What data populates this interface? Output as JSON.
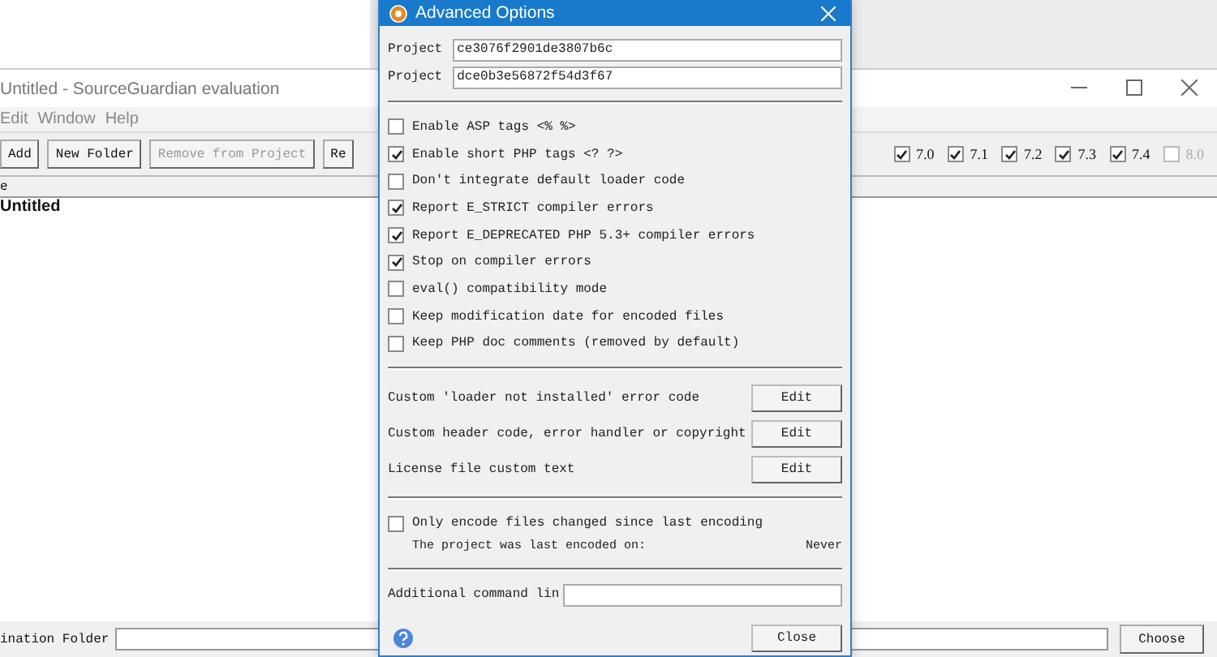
{
  "main_window": {
    "title": "Untitled - SourceGuardian evaluation",
    "menu": [
      "Edit",
      "Window",
      "Help"
    ],
    "toolbar": [
      {
        "label": "Add",
        "disabled": false
      },
      {
        "label": "New Folder",
        "disabled": false
      },
      {
        "label": "Remove from Project",
        "disabled": true
      },
      {
        "label": "Re",
        "disabled": false
      }
    ],
    "versions": [
      {
        "label": "7.0",
        "checked": true,
        "disabled": false
      },
      {
        "label": "7.1",
        "checked": true,
        "disabled": false
      },
      {
        "label": "7.2",
        "checked": true,
        "disabled": false
      },
      {
        "label": "7.3",
        "checked": true,
        "disabled": false
      },
      {
        "label": "7.4",
        "checked": true,
        "disabled": false
      },
      {
        "label": "8.0",
        "checked": false,
        "disabled": true
      }
    ],
    "column_1": "e",
    "tree": [
      {
        "label": "Untitled"
      }
    ],
    "destination_label": "ination Folder",
    "choose_button": "Choose"
  },
  "dialog": {
    "title": "Advanced Options",
    "projects": [
      {
        "label": "Project",
        "value": "ce3076f2901de3807b6c"
      },
      {
        "label": "Project",
        "value": "dce0b3e56872f54d3f67"
      }
    ],
    "options": [
      {
        "label": "Enable ASP tags <% %>",
        "checked": false
      },
      {
        "label": "Enable short PHP tags <? ?>",
        "checked": true
      },
      {
        "label": "Don't integrate default loader code",
        "checked": false
      },
      {
        "label": "Report E_STRICT compiler errors",
        "checked": true
      },
      {
        "label": "Report E_DEPRECATED PHP 5.3+ compiler errors",
        "checked": true
      },
      {
        "label": "Stop on compiler errors",
        "checked": true
      },
      {
        "label": "eval() compatibility mode",
        "checked": false
      },
      {
        "label": "Keep modification date for encoded files",
        "checked": false
      },
      {
        "label": "Keep PHP doc comments (removed by default)",
        "checked": false
      }
    ],
    "edit_rows": [
      {
        "label": "Custom 'loader not installed' error code",
        "button": "Edit"
      },
      {
        "label": "Custom header code, error handler or copyright",
        "button": "Edit"
      },
      {
        "label": "License file custom text",
        "button": "Edit"
      }
    ],
    "only_changed": {
      "label": "Only encode files changed since last encoding",
      "checked": false
    },
    "last_encoded": {
      "label": "The project was last encoded on:",
      "value": "Never"
    },
    "command_line_label": "Additional command lin",
    "close_button": "Close"
  }
}
